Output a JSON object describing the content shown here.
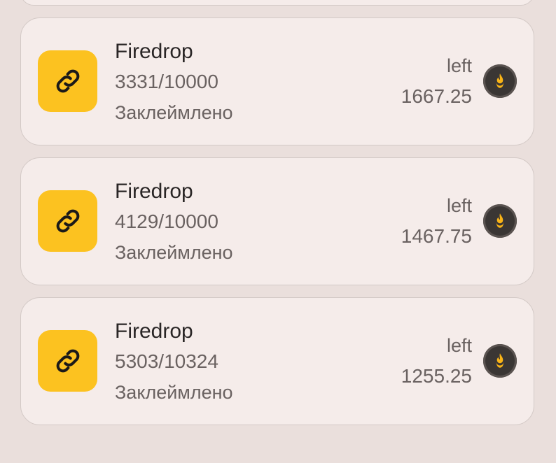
{
  "drops": [
    {
      "title": "Firedrop",
      "progress": "3331/10000",
      "status": "Заклеймлено",
      "left_label": "left",
      "left_value": "1667.25",
      "icon": "link-icon",
      "badge_icon": "fire-icon"
    },
    {
      "title": "Firedrop",
      "progress": "4129/10000",
      "status": "Заклеймлено",
      "left_label": "left",
      "left_value": "1467.75",
      "icon": "link-icon",
      "badge_icon": "fire-icon"
    },
    {
      "title": "Firedrop",
      "progress": "5303/10324",
      "status": "Заклеймлено",
      "left_label": "left",
      "left_value": "1255.25",
      "icon": "link-icon",
      "badge_icon": "fire-icon"
    }
  ],
  "colors": {
    "background": "#eadfdc",
    "card": "#f5ecea",
    "accent_yellow": "#fcc220",
    "badge_dark": "#3a3634",
    "flame": "#f9b417"
  }
}
